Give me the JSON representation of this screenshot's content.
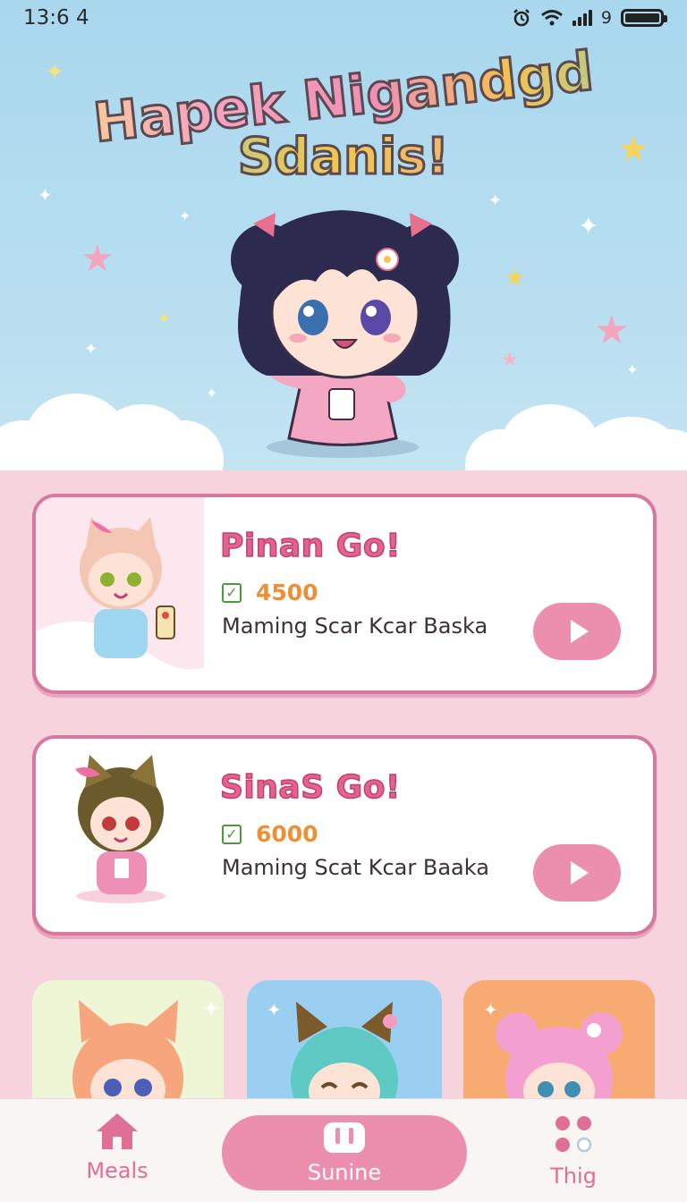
{
  "status_bar": {
    "time": "13:6 4",
    "signal_text": "9",
    "icons": [
      "alarm-icon",
      "wifi-icon",
      "signal-icon",
      "battery-icon"
    ]
  },
  "hero": {
    "title_line1": "Hapek Nigandgd",
    "title_line2": "Sdanis!"
  },
  "games": [
    {
      "title": "Pinan Go!",
      "score": "4500",
      "description": "Maming Scar Kcar Baska",
      "action_icon": "play-icon"
    },
    {
      "title": "SinaS Go!",
      "score": "6000",
      "description": "Maming Scat Kcar Baaka",
      "action_icon": "play-icon"
    }
  ],
  "bottom_nav": {
    "left_label": "Meals",
    "center_label": "Sunine",
    "right_label": "Thig"
  },
  "colors": {
    "accent_pink": "#ec8fae",
    "title_pink": "#e5628f",
    "score_orange": "#ee8e35",
    "check_green": "#4c9a3b",
    "page_pink": "#f7d3dd",
    "sky_blue": "#a9d7ee"
  }
}
